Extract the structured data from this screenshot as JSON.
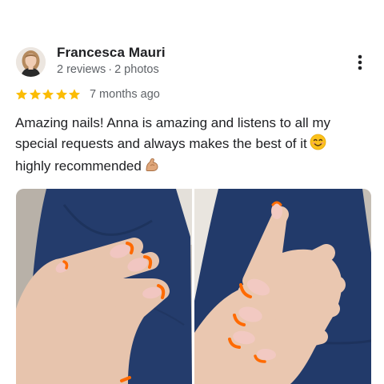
{
  "review": {
    "author": {
      "name": "Francesca Mauri",
      "reviews_count": "2 reviews",
      "photos_count": "2 photos",
      "separator": "·"
    },
    "rating": 5,
    "max_rating": 5,
    "time": "7 months ago",
    "text_lines": [
      "Amazing nails! Anna is amazing and listens to all my",
      "special requests and always makes the best of it",
      "highly recommended"
    ],
    "photos": [
      {
        "name": "review-photo-1"
      },
      {
        "name": "review-photo-2"
      }
    ]
  },
  "icons": {
    "more": "more-vertical-icon",
    "star": "star-icon",
    "smile": "smiling-face-emoji",
    "muscle": "flexed-biceps-emoji"
  },
  "colors": {
    "star": "#fbbc04",
    "text": "#202124",
    "secondary_text": "#5f6368",
    "nail_polish": "#ff6a00",
    "sleeve": "#233a6b"
  }
}
